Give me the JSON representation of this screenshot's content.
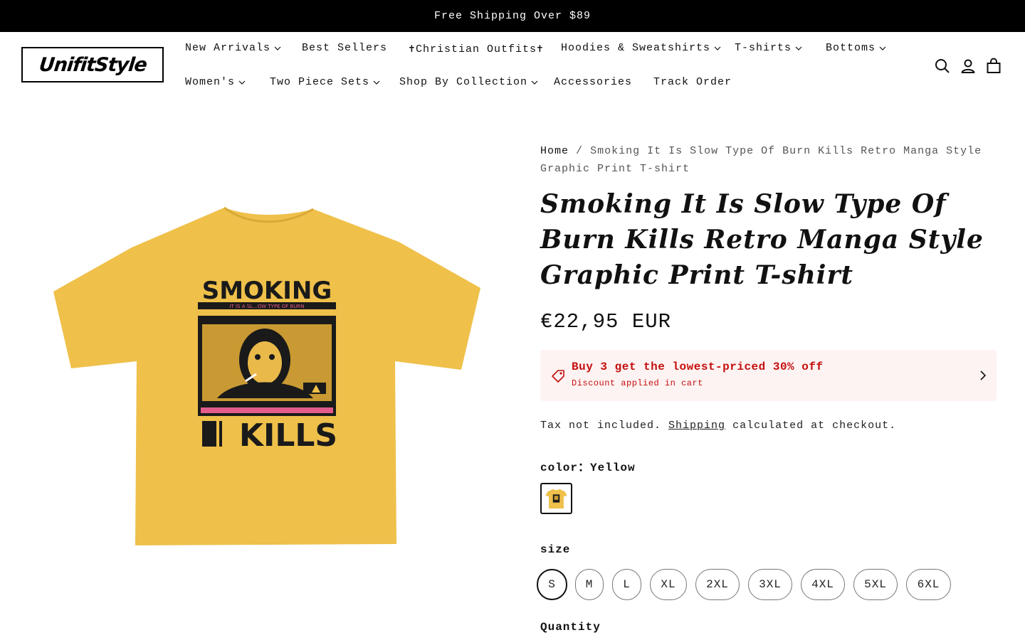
{
  "announcement": {
    "text": "Free Shipping Over $89"
  },
  "header": {
    "logo_text": "UnifitStyle",
    "nav": [
      {
        "label": "New Arrivals",
        "dropdown": true
      },
      {
        "label": "Best Sellers",
        "dropdown": false
      },
      {
        "label": "✝Christian Outfits✝",
        "dropdown": false
      },
      {
        "label": "Hoodies & Sweatshirts",
        "dropdown": true
      },
      {
        "label": "T-shirts",
        "dropdown": true
      },
      {
        "label": "Bottoms",
        "dropdown": true
      },
      {
        "label": "Women's",
        "dropdown": true
      },
      {
        "label": "Two Piece Sets",
        "dropdown": true
      },
      {
        "label": "Shop By Collection",
        "dropdown": true
      },
      {
        "label": "Accessories",
        "dropdown": false
      },
      {
        "label": "Track Order",
        "dropdown": false
      }
    ],
    "icons": [
      "search-icon",
      "account-icon",
      "cart-icon"
    ]
  },
  "product": {
    "image_text": {
      "top": "SMOKING",
      "small": "IT IS A SL...OW TYPE OF BURN",
      "bottom": "KILLS"
    },
    "breadcrumb": {
      "home": "Home",
      "separator": "/",
      "current": "Smoking It Is Slow Type Of Burn Kills Retro Manga Style Graphic Print T-shirt"
    },
    "title": "Smoking It Is Slow Type Of Burn Kills Retro Manga Style Graphic Print T-shirt",
    "price": "€22,95 EUR",
    "promo": {
      "title": "Buy 3 get the lowest-priced 30% off",
      "subtitle": "Discount applied in cart"
    },
    "tax": {
      "before": "Tax not included.",
      "link": "Shipping",
      "after": "calculated at checkout."
    },
    "color": {
      "label": "color：Yellow",
      "value": "Yellow",
      "hex": "#EFC04A"
    },
    "size": {
      "label": "size",
      "options": [
        "S",
        "M",
        "L",
        "XL",
        "2XL",
        "3XL",
        "4XL",
        "5XL",
        "6XL"
      ],
      "selected": "S"
    },
    "quantity_label": "Quantity"
  },
  "colors": {
    "accent_red": "#C40E0E",
    "promo_bg": "#FDF3F2",
    "shirt_yellow": "#EFC04A"
  }
}
